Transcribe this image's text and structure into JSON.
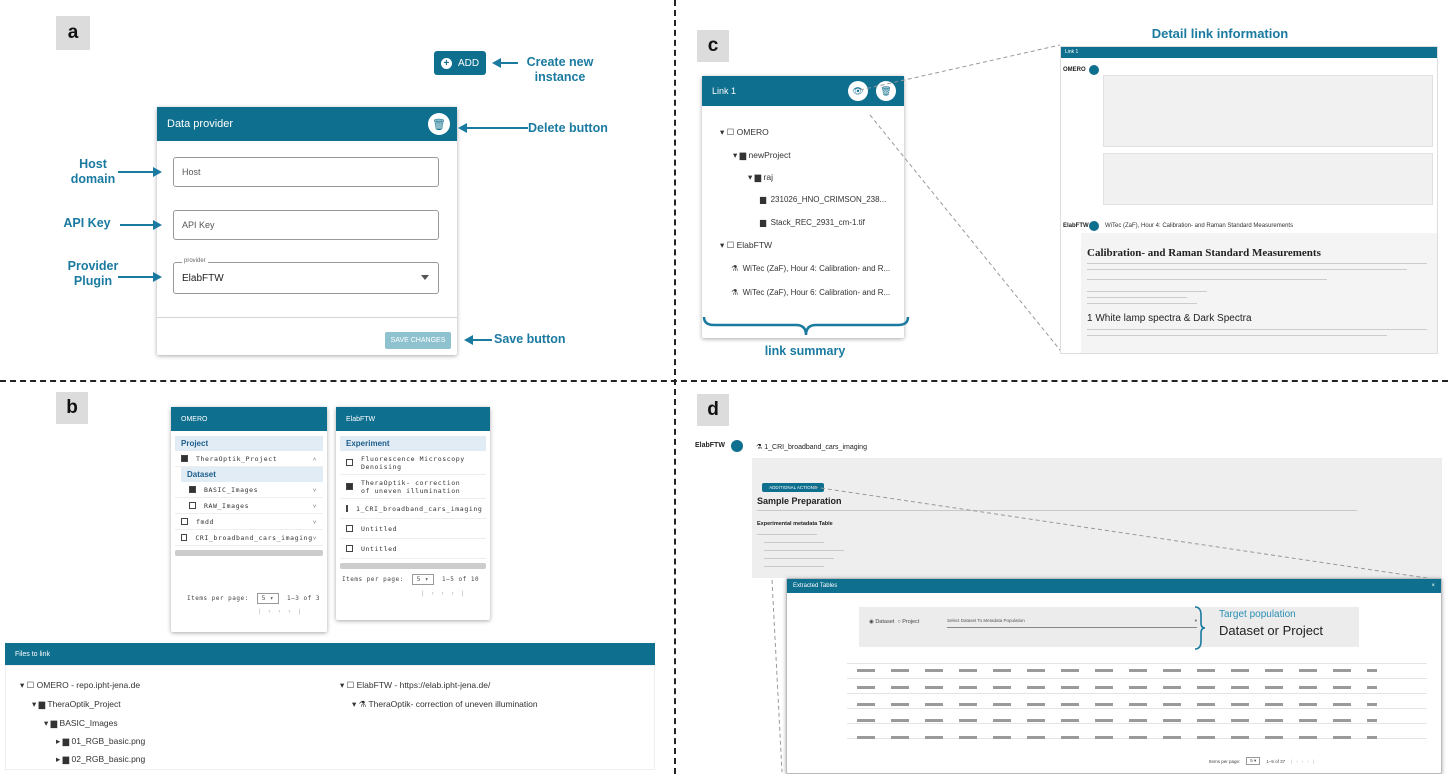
{
  "panels": {
    "a": "a",
    "b": "b",
    "c": "c",
    "d": "d"
  },
  "a": {
    "add_label": "ADD",
    "card_title": "Data provider",
    "host_placeholder": "Host",
    "apikey_placeholder": "API Key",
    "provider_label": "provider",
    "provider_value": "ElabFTW",
    "save_label": "SAVE CHANGES",
    "annot_create": "Create new\ninstance",
    "annot_delete": "Delete button",
    "annot_host": "Host\ndomain",
    "annot_api": "API Key",
    "annot_plugin": "Provider\nPlugin",
    "annot_save": "Save button"
  },
  "b": {
    "omero_title": "OMERO",
    "omero_project_header": "Project",
    "omero_project": "TheraOptik_Project",
    "omero_dataset_header": "Dataset",
    "ds1": "BASIC_Images",
    "ds2": "RAW_Images",
    "proj2": "fmdd",
    "proj3": "CRI_broadband_cars_imaging",
    "omero_ipp_label": "Items per page:",
    "omero_ipp_value": "5",
    "omero_range": "1–3 of 3",
    "elab_title": "ElabFTW",
    "elab_header": "Experiment",
    "exp1": "Fluorescence Microscopy Denoising",
    "exp2": "TheraOptik- correction of uneven illumination",
    "exp3": "1_CRI_broadband_cars_imaging",
    "exp4": "Untitled",
    "exp5": "Untitled",
    "elab_ipp_label": "Items per page:",
    "elab_ipp_value": "5",
    "elab_range": "1–5 of 10",
    "files_title": "Files to link",
    "f_omero": "OMERO - repo.ipht-jena.de",
    "f_project": "TheraOptik_Project",
    "f_dataset": "BASIC_Images",
    "f_img1": "01_RGB_basic.png",
    "f_img2": "02_RGB_basic.png",
    "f_elab": "ElabFTW - https://elab.ipht-jena.de/",
    "f_exp": "TheraOptik- correction of uneven illumination"
  },
  "c": {
    "detail_title": "Detail link information",
    "link_title": "Link 1",
    "omero": "OMERO",
    "project": "newProject",
    "dataset": "raj",
    "img1": "231026_HNO_CRIMSON_238...",
    "img2": "Stack_REC_2931_cm-1.tif",
    "elab": "ElabFTW",
    "exp1": "WiTec (ZaF), Hour 4: Calibration- and R...",
    "exp2": "WiTec (ZaF), Hour 6: Calibration- and R...",
    "summary": "link summary",
    "side_omero": "OMERO",
    "side_elab": "ElabFTW",
    "doc_heading": "Calibration- and Raman Standard Measurements",
    "doc_sub": "1 White lamp spectra & Dark Spectra",
    "doc_exp_title": "WiTec (ZaF), Hour 4: Calibration- and Raman Standard Measurements"
  },
  "d": {
    "side_elab": "ElabFTW",
    "exp_title": "1_CRI_broadband_cars_imaging",
    "actions": "ADDITIONAL ACTIONS",
    "sample_prep": "Sample Preparation",
    "meta_table": "Experimental metadata Table",
    "tables_title": "Extracted Tables",
    "target_label": "Target population",
    "target_value": "Dataset or Project",
    "radio1": "Dataset",
    "radio2": "Project",
    "select_placeholder": "Select Dataset To Metadata Population",
    "ipp_label": "Items per page:",
    "ipp_value": "5",
    "range": "1–5 of 37"
  }
}
